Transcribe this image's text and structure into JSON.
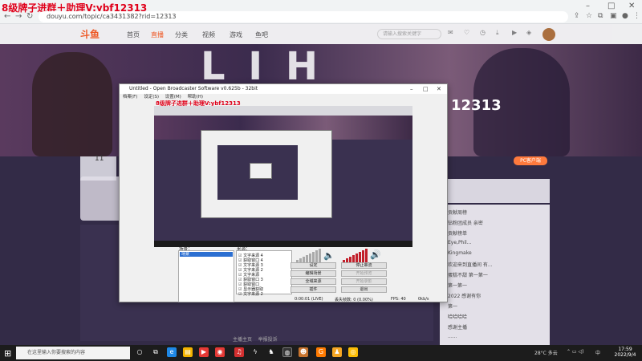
{
  "browser": {
    "overlay_text": "8级牌子进群＋助理V:ybf12313",
    "url": "douyu.com/topic/ca3431382?rid=12313",
    "window_controls": [
      "–",
      "□",
      "✕"
    ]
  },
  "site": {
    "logo": "斗鱼",
    "nav": [
      "首页",
      "直播",
      "分类",
      "视频",
      "游戏",
      "鱼吧"
    ],
    "search_placeholder": "请输入搜索关键字",
    "header_icons": [
      "消息",
      "关注",
      "历史",
      "下载",
      "开播",
      "提示"
    ]
  },
  "banner": {
    "title": "L I H",
    "room_number": "12313"
  },
  "left": {
    "fans_count": "11"
  },
  "right": {
    "pc_button": "PC客户端",
    "chat_lines": [
      {
        "badge": "",
        "badge_color": "o",
        "text": "贡献周榜"
      },
      {
        "badge": "",
        "badge_color": "o",
        "text": "钻粉团成员  亲密"
      },
      {
        "badge": "",
        "badge_color": "p",
        "text": "贡献榜单"
      },
      {
        "badge": "",
        "badge_color": "o",
        "text": "Eye,Phil..."
      },
      {
        "badge": "",
        "badge_color": "g",
        "text": "Kingmake"
      },
      {
        "badge": "",
        "badge_color": "o",
        "text": "欢迎来到直播间 有..."
      },
      {
        "badge": "",
        "badge_color": "g",
        "text": "蛋糕不甜 第一第一"
      },
      {
        "badge": "",
        "badge_color": "g",
        "text": "第一第一"
      },
      {
        "badge": "",
        "badge_color": "o",
        "text": "2022 感谢有你"
      },
      {
        "badge": "",
        "badge_color": "o",
        "text": "第一"
      },
      {
        "badge": "",
        "badge_color": "p",
        "text": "哈哈哈哈"
      },
      {
        "badge": "",
        "badge_color": "o",
        "text": "感谢主播"
      },
      {
        "badge": "",
        "badge_color": "o",
        "text": "......"
      }
    ]
  },
  "footer": {
    "links": [
      "主播主页",
      "举报投诉"
    ]
  },
  "obs": {
    "title": "Untitled - Open Broadcaster Software v0.625b - 32bit",
    "menu": [
      "档案(F)",
      "设定(S)",
      "设置(M)",
      "帮助(H)"
    ],
    "preview_overlay": "8级牌子进群＋助理V:ybf12313",
    "scenes_label": "场景：",
    "sources_label": "来源：",
    "scenes": [
      "场景"
    ],
    "sources": [
      "文字来源 4",
      "获取窗口 4",
      "文字来源 3",
      "文字来源 2",
      "文字来源",
      "获取窗口 3",
      "获取窗口",
      "显示器获取",
      "文字来源 2"
    ],
    "buttons": {
      "settings": "设定",
      "stop_stream": "停止串流",
      "edit_scene": "编辑场景",
      "global_sources": "全域来源",
      "plugins": "插件",
      "exit": "退出",
      "disabled1": "开始预览",
      "disabled2": "开始录影"
    },
    "status": {
      "time": "0:00:01 (LIVE)",
      "dropped": "丢失帧数: 0 (0.00%)",
      "fps": "FPS: 40",
      "bitrate": "0kb/s"
    }
  },
  "taskbar": {
    "search_placeholder": "在这里输入你要搜索的内容",
    "weather": "28°C 多云",
    "ime": "中",
    "time": "17:59",
    "date": "2022/9/4"
  }
}
